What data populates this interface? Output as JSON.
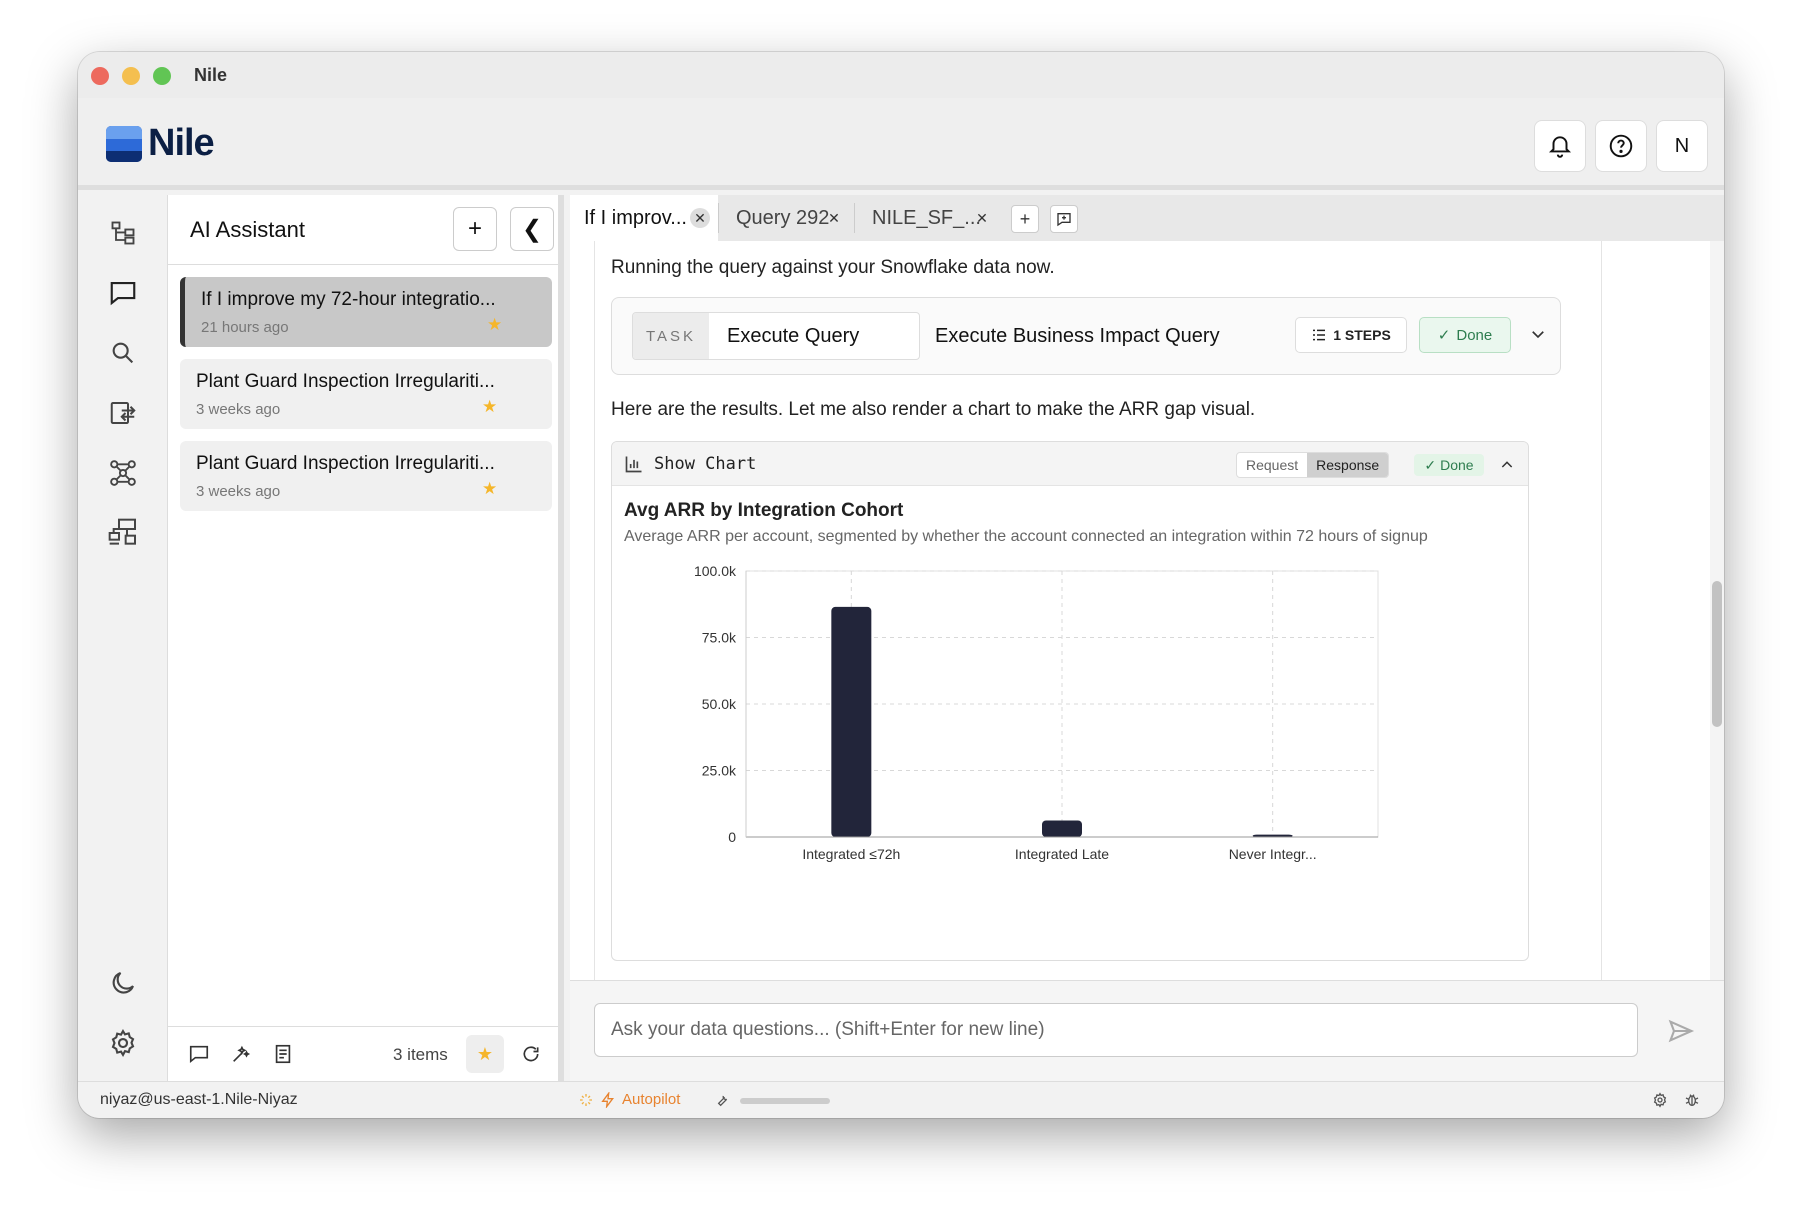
{
  "window": {
    "title": "Nile"
  },
  "header": {
    "logo_text": "Nile",
    "user_initial": "N"
  },
  "rail": {
    "icons": [
      "schema-tree-icon",
      "chat-icon",
      "search-icon",
      "import-export-icon",
      "network-graph-icon",
      "hierarchy-icon",
      "moon-icon",
      "gear-icon"
    ]
  },
  "ai_panel": {
    "title": "AI Assistant",
    "add_label": "+",
    "collapse_label": "❮",
    "conversations": [
      {
        "title": "If I improve my 72-hour integratio...",
        "time": "21 hours ago",
        "starred": true
      },
      {
        "title": "Plant Guard Inspection Irregulariti...",
        "time": "3 weeks ago",
        "starred": true
      },
      {
        "title": "Plant Guard Inspection Irregulariti...",
        "time": "3 weeks ago",
        "starred": true
      }
    ],
    "footer": {
      "items_count": "3 items"
    }
  },
  "tabs": [
    {
      "label": "If I improv...",
      "active": true
    },
    {
      "label": "Query 292",
      "active": false
    },
    {
      "label": "NILE_SF_...",
      "active": false
    }
  ],
  "tab_actions": {
    "add_label": "+"
  },
  "chat": {
    "msg1": "Running the query against your Snowflake data now.",
    "task": {
      "tag": "TASK",
      "name": "Execute Query",
      "description": "Execute Business Impact Query",
      "steps": "1 STEPS",
      "status": "Done"
    },
    "msg2": "Here are the results. Let me also render a chart to make the ARR gap visual.",
    "chart_card": {
      "tool_name": "Show Chart",
      "request_label": "Request",
      "response_label": "Response",
      "status": "Done"
    }
  },
  "chart_data": {
    "type": "bar",
    "title": "Avg ARR by Integration Cohort",
    "subtitle": "Average ARR per account, segmented by whether the account connected an integration within 72 hours of signup",
    "categories": [
      "Integrated ≤72h",
      "Integrated Late",
      "Never Integr..."
    ],
    "values": [
      86500,
      6200,
      900
    ],
    "ylim": [
      0,
      100000
    ],
    "yticks": [
      {
        "value": 0,
        "label": "0"
      },
      {
        "value": 25000,
        "label": "25.0k"
      },
      {
        "value": 50000,
        "label": "50.0k"
      },
      {
        "value": 75000,
        "label": "75.0k"
      },
      {
        "value": 100000,
        "label": "100.0k"
      }
    ],
    "grid": true,
    "bar_color": "#22253a"
  },
  "input": {
    "placeholder": "Ask your data questions... (Shift+Enter for new line)"
  },
  "statusbar": {
    "user_host": "niyaz@us-east-1.Nile-Niyaz",
    "autopilot_label": "Autopilot"
  },
  "colors": {
    "accent_orange": "#e8832f",
    "done_green": "#2e7d4f",
    "star": "#f5b62a"
  }
}
